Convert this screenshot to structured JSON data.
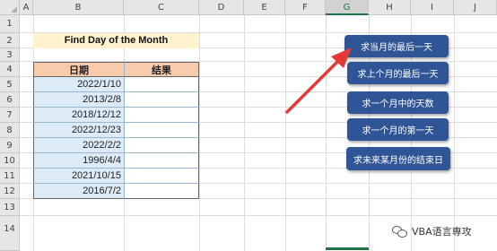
{
  "spreadsheet": {
    "columns": [
      "A",
      "B",
      "C",
      "D",
      "E",
      "F",
      "G",
      "H",
      "I",
      "J"
    ],
    "selected_column": "G",
    "rows": [
      "1",
      "2",
      "3",
      "4",
      "5",
      "6",
      "7",
      "8",
      "9",
      "10",
      "11",
      "12",
      "13",
      "14"
    ]
  },
  "title": "Find Day of the Month",
  "table": {
    "headers": [
      "日期",
      "结果"
    ],
    "dates": [
      "2022/1/10",
      "2013/2/8",
      "2018/12/12",
      "2022/12/23",
      "2022/2/2",
      "1996/4/4",
      "2021/10/15",
      "2016/7/2"
    ]
  },
  "buttons": {
    "b1": "求当月的最后一天",
    "b2": "求上个月的最后一天",
    "b3": "求一个月中的天数",
    "b4": "求一个月的第一天",
    "b5": "求未来某月份的结束日"
  },
  "watermark": {
    "text": "VBA语言専攻"
  },
  "colors": {
    "button": "#2f5597",
    "arrow": "#e53935",
    "title_fill": "#fff2cc",
    "header_fill": "#f8cbad",
    "date_fill": "#ddebf7"
  }
}
